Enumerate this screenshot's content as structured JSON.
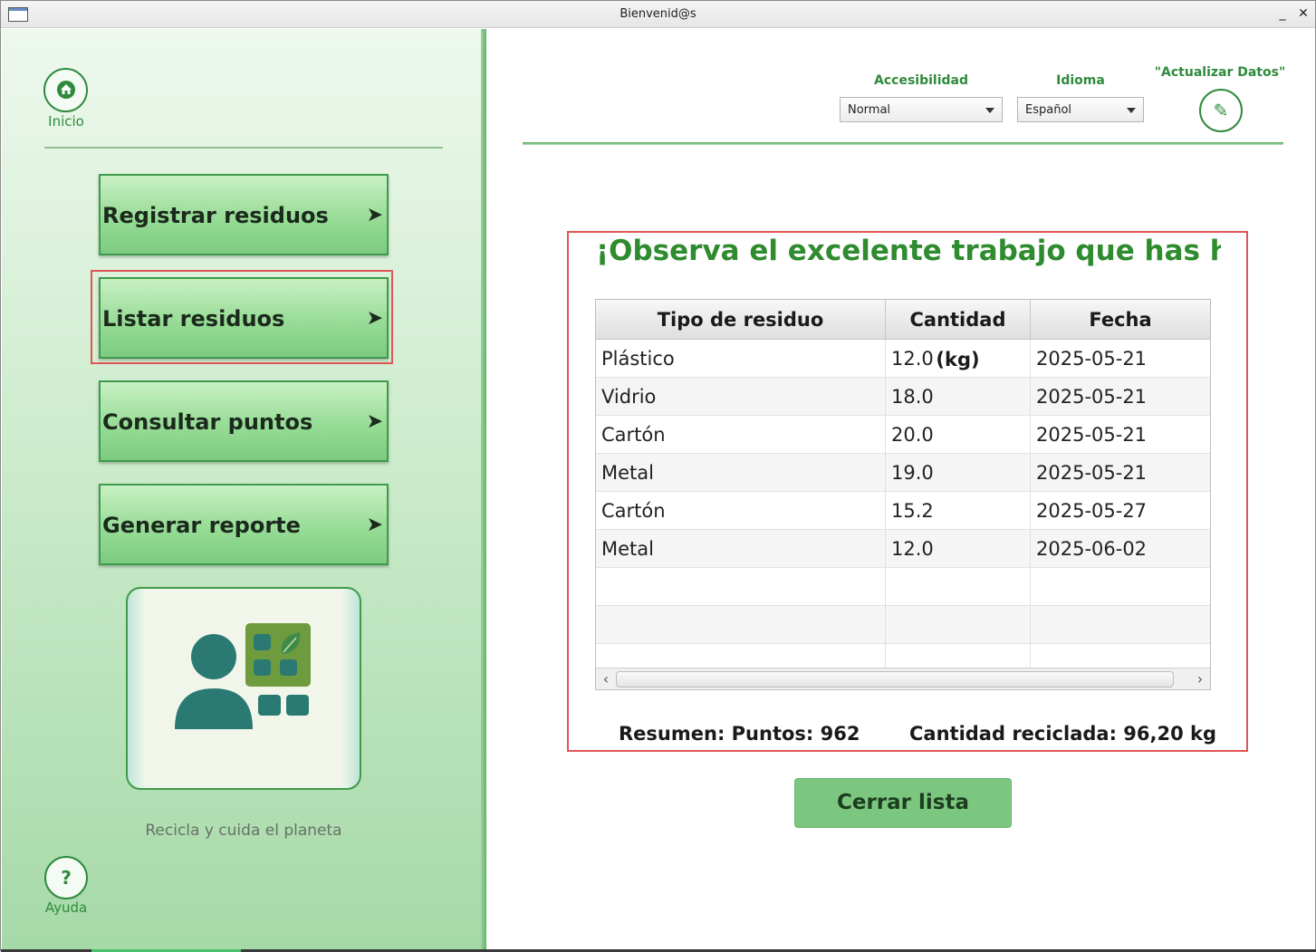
{
  "window": {
    "title": "Bienvenid@s",
    "minimize": "_",
    "close": "✕"
  },
  "sidebar": {
    "home_label": "Inicio",
    "help_label": "Ayuda",
    "help_glyph": "?",
    "nav": [
      {
        "label": "Registrar residuos",
        "arrow": "➤"
      },
      {
        "label": "Listar residuos",
        "arrow": "➤"
      },
      {
        "label": "Consultar puntos",
        "arrow": "➤"
      },
      {
        "label": "Generar reporte",
        "arrow": "➤"
      }
    ],
    "tagline": "Recicla y cuida el planeta",
    "illustration": "person-with-recycling-app-icon"
  },
  "settings": {
    "accessibility_label": "Accesibilidad",
    "accessibility_value": "Normal",
    "language_label": "Idioma",
    "language_value": "Español",
    "update_label": "\"Actualizar Datos\"",
    "update_glyph": "✎"
  },
  "panel": {
    "title": "¡Observa el excelente trabajo que has he...",
    "columns": [
      "Tipo de residuo",
      "Cantidad (kg)",
      "Fecha"
    ],
    "rows": [
      [
        "Plástico",
        "12.0",
        "2025-05-21"
      ],
      [
        "Vidrio",
        "18.0",
        "2025-05-21"
      ],
      [
        "Cartón",
        "20.0",
        "2025-05-21"
      ],
      [
        "Metal",
        "19.0",
        "2025-05-21"
      ],
      [
        "Cartón",
        "15.2",
        "2025-05-27"
      ],
      [
        "Metal",
        "12.0",
        "2025-06-02"
      ],
      [
        "",
        "",
        ""
      ],
      [
        "",
        "",
        ""
      ],
      [
        "",
        "",
        ""
      ]
    ],
    "summary_points": "Resumen: Puntos: 962",
    "summary_amount": "Cantidad reciclada: 96,20 kg"
  },
  "actions": {
    "close_list": "Cerrar lista"
  },
  "colors": {
    "brand_green": "#2f8a3c",
    "title_green": "#2e8b2e",
    "focus_red": "#e05555",
    "button_green": "#7cc77f"
  }
}
